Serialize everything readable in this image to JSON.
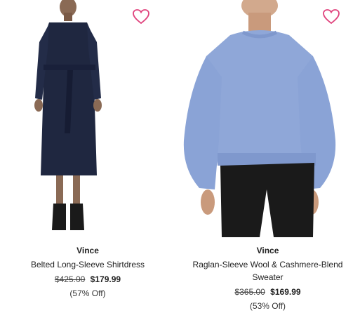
{
  "colors": {
    "heart": "#e0427c",
    "dress": "#1f2740",
    "sweater": "#8fa7d8",
    "skin": "#c99a7c",
    "leggings": "#1a1a1a",
    "boots": "#1a1a1a"
  },
  "products": [
    {
      "brand": "Vince",
      "name": "Belted Long-Sleeve Shirtdress",
      "original_price": "$425.00",
      "sale_price": "$179.99",
      "discount": "(57% Off)",
      "favorite_icon": "heart-outline-icon"
    },
    {
      "brand": "Vince",
      "name": "Raglan-Sleeve Wool & Cashmere-Blend Sweater",
      "original_price": "$365.00",
      "sale_price": "$169.99",
      "discount": "(53% Off)",
      "favorite_icon": "heart-outline-icon"
    }
  ]
}
